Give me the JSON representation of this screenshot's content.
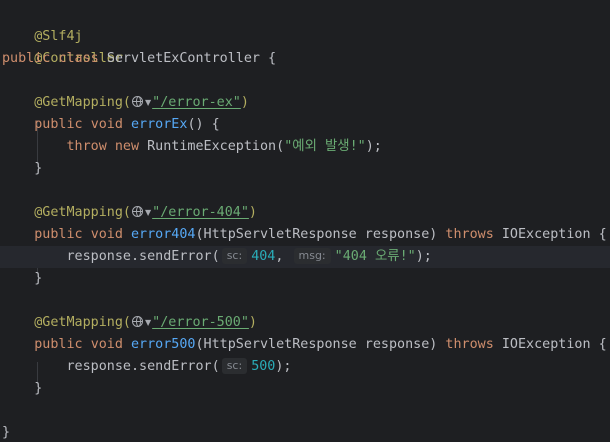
{
  "code": {
    "class_annotations": [
      "@Slf4j",
      "@Controller"
    ],
    "class_decl": {
      "public_kw": "public",
      "class_kw": "class",
      "class_name": "ServletExController",
      "open_brace": " {"
    },
    "methods": [
      {
        "mapping_annotation": "@GetMapping(",
        "path": "\"/error-ex\"",
        "mapping_close": ")",
        "public_kw": "public",
        "void_kw": "void",
        "name": "errorEx",
        "params": "() {",
        "body": {
          "throw_kw": "throw",
          "new_kw": "new",
          "text": "RuntimeException(",
          "message": "\"예외 발생!\"",
          "end": ");"
        },
        "close_brace": "}"
      },
      {
        "mapping_annotation": "@GetMapping(",
        "path": "\"/error-404\"",
        "mapping_close": ")",
        "public_kw": "public",
        "void_kw": "void",
        "name": "error404",
        "params": "(HttpServletResponse response)",
        "throws_kw": "throws",
        "exception": "IOException {",
        "body": {
          "text": "response.sendError(",
          "hint_sc": "sc:",
          "sc_value": "404",
          "sep": ", ",
          "hint_msg": "msg:",
          "message": "\"404 오류!\"",
          "end": ");"
        },
        "close_brace": "}"
      },
      {
        "mapping_annotation": "@GetMapping(",
        "path": "\"/error-500\"",
        "mapping_close": ")",
        "public_kw": "public",
        "void_kw": "void",
        "name": "error500",
        "params": "(HttpServletResponse response)",
        "throws_kw": "throws",
        "exception": "IOException {",
        "body": {
          "text": "response.sendError(",
          "hint_sc": "sc:",
          "sc_value": "500",
          "end": ");"
        },
        "close_brace": "}"
      }
    ],
    "class_close": "}"
  },
  "colors": {
    "background": "#1e1f22",
    "current_line": "#26282e",
    "annotation": "#b3ae60",
    "keyword": "#cf8e6d",
    "function": "#56a8f5",
    "string": "#6aab73",
    "number": "#2aacb8",
    "text": "#bcbec4",
    "hint_bg": "#2b2d30",
    "hint_text": "#868a91"
  },
  "icons": {
    "mapping_icon": "globe-icon",
    "mapping_dropdown": "chevron-down-icon"
  }
}
